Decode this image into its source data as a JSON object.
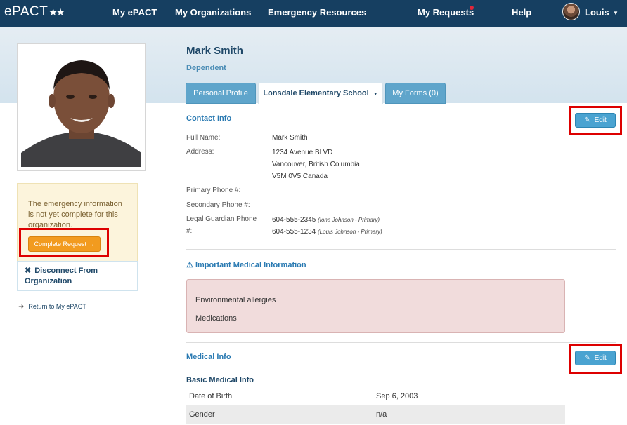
{
  "nav": {
    "brand": "ePACT",
    "brand_stars": "★★",
    "links": [
      "My ePACT",
      "My Organizations",
      "Emergency Resources",
      "My Requests",
      "Help"
    ],
    "user": "Louis"
  },
  "profile": {
    "name": "Mark Smith",
    "role": "Dependent"
  },
  "sidebar": {
    "warning": "The emergency information is not yet complete for this organization.",
    "complete_button": "Complete Request →",
    "disconnect": "Disconnect From Organization",
    "disconnect_icon": "✖",
    "return_link": "Return to My ePACT"
  },
  "tabs": [
    {
      "label": "Personal Profile",
      "active": false
    },
    {
      "label": "Lonsdale Elementary School",
      "active": true
    },
    {
      "label": "My Forms (0)",
      "active": false
    }
  ],
  "contact": {
    "title": "Contact Info",
    "edit_label": "Edit",
    "full_name_label": "Full Name:",
    "full_name": "Mark Smith",
    "address_label": "Address:",
    "address_line1": "1234 Avenue BLVD",
    "address_line2": "Vancouver, British Columbia",
    "address_line3": "V5M 0V5 Canada",
    "primary_phone_label": "Primary Phone #:",
    "secondary_phone_label": "Secondary Phone #:",
    "guardian_label_1": "Legal Guardian Phone",
    "guardian_label_2": "#:",
    "guardian_phone_1": "604-555-2345",
    "guardian_note_1": "(Iona Johnson - Primary)",
    "guardian_phone_2": "604-555-1234",
    "guardian_note_2": "(Louis Johnson - Primary)"
  },
  "important_medical": {
    "title": "Important Medical Information",
    "icon": "⚠",
    "items": [
      "Environmental allergies",
      "Medications"
    ]
  },
  "medical": {
    "title": "Medical Info",
    "edit_label": "Edit",
    "subtitle": "Basic Medical Info",
    "rows": [
      {
        "label": "Date of Birth",
        "value": "Sep 6, 2003"
      },
      {
        "label": "Gender",
        "value": "n/a"
      }
    ]
  },
  "colors": {
    "nav_bg": "#163f61",
    "accent_blue": "#4aa3d1",
    "complete_orange": "#f29b1f",
    "highlight_red": "#dd0000"
  }
}
